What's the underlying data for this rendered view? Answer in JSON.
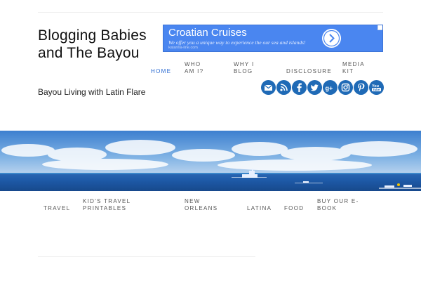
{
  "site": {
    "title": "Blogging Babies and The Bayou",
    "tagline": "Bayou Living with Latin Flare"
  },
  "ad": {
    "title": "Croatian Cruises",
    "description": "We offer you a unique way to experience the our sea and islands!",
    "url": "katarina-line.com"
  },
  "primary_nav": [
    {
      "label": "HOME",
      "active": true
    },
    {
      "label": "WHO AM I?"
    },
    {
      "label": "WHY I BLOG"
    },
    {
      "label": "DISCLOSURE"
    },
    {
      "label": "MEDIA KIT"
    }
  ],
  "social_icons": [
    "email-icon",
    "rss-icon",
    "facebook-icon",
    "twitter-icon",
    "google-plus-icon",
    "instagram-icon",
    "pinterest-icon",
    "youtube-icon"
  ],
  "secondary_nav": [
    {
      "label": "TRAVEL"
    },
    {
      "label": "KID'S TRAVEL PRINTABLES"
    },
    {
      "label": "NEW ORLEANS"
    },
    {
      "label": "LATINA"
    },
    {
      "label": "FOOD"
    },
    {
      "label": "BUY OUR E-BOOK"
    }
  ],
  "colors": {
    "accent": "#2a6ad1",
    "social_icon": "#1f6ab6",
    "ad_background": "#4a86f0",
    "sea": "#1f5da6",
    "sky": "#5a9ad8"
  }
}
